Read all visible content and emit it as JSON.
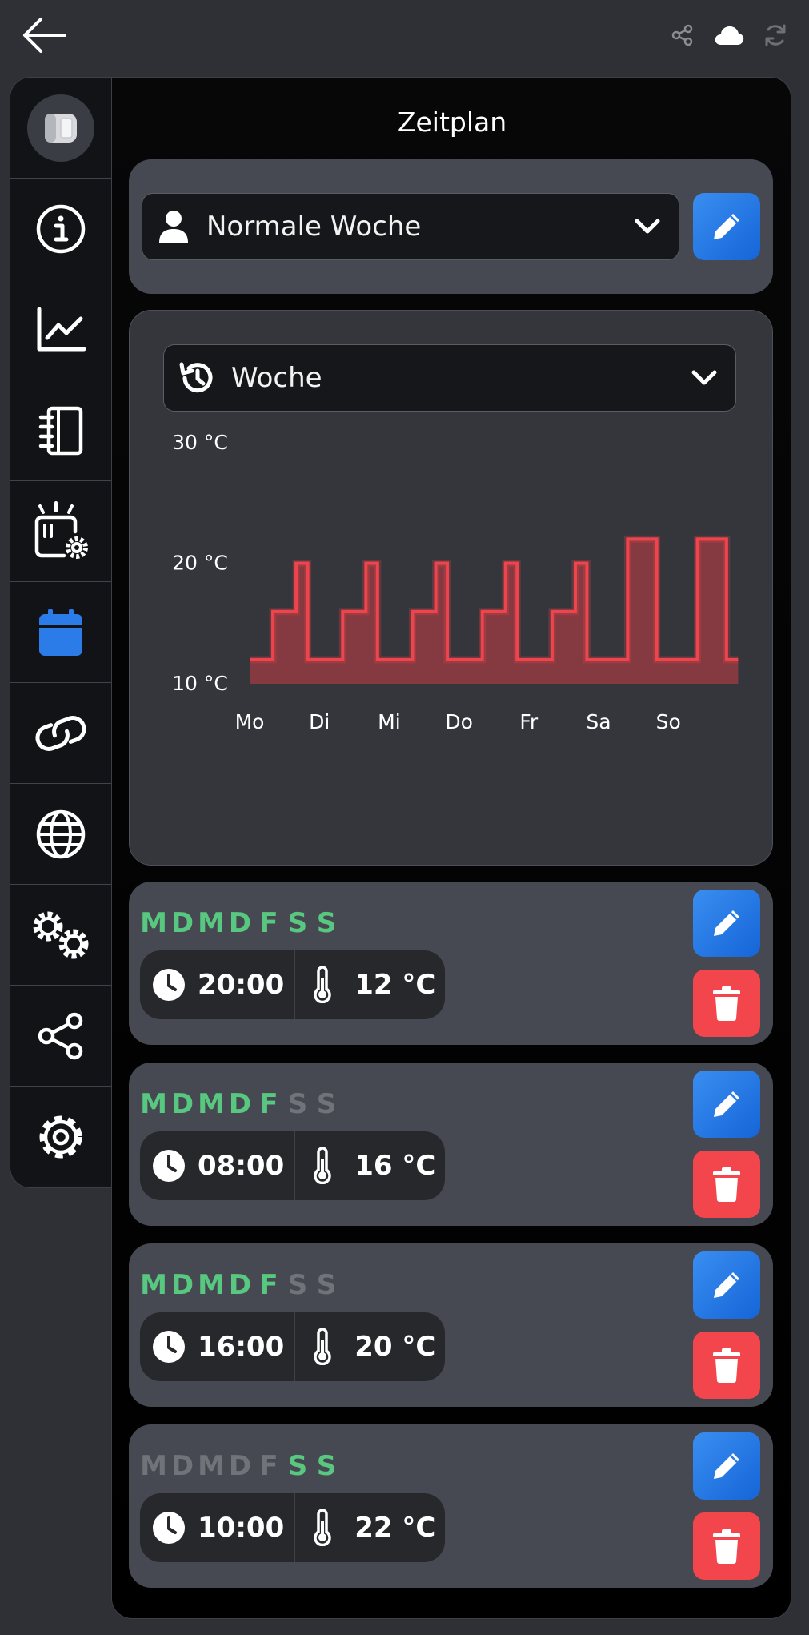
{
  "header": {
    "back_icon": "arrow-left-icon",
    "icons": [
      "share-icon",
      "cloud-icon",
      "sync-icon"
    ]
  },
  "sidebar": {
    "items": [
      {
        "name": "device",
        "icon": "thermostat-device-icon"
      },
      {
        "name": "info",
        "icon": "info-icon"
      },
      {
        "name": "history",
        "icon": "chart-line-icon"
      },
      {
        "name": "log",
        "icon": "notebook-icon"
      },
      {
        "name": "device-settings",
        "icon": "device-gear-icon"
      },
      {
        "name": "schedule",
        "icon": "calendar-icon",
        "active": true
      },
      {
        "name": "links",
        "icon": "link-icon"
      },
      {
        "name": "network",
        "icon": "globe-icon"
      },
      {
        "name": "advanced",
        "icon": "gears-icon"
      },
      {
        "name": "share",
        "icon": "share-icon"
      },
      {
        "name": "settings",
        "icon": "gear-icon"
      }
    ]
  },
  "page": {
    "title": "Zeitplan"
  },
  "profile_select": {
    "value": "Normale Woche"
  },
  "view_select": {
    "value": "Woche"
  },
  "colors": {
    "accent_blue": "#2b7ce9",
    "active_day": "#58c77f",
    "inactive_day": "#70737a",
    "delete_red": "#f2454c",
    "chart_line": "#f0444c",
    "chart_fill": "#8a3a40"
  },
  "chart_data": {
    "type": "area",
    "y_tick_labels": [
      "30 °C",
      "20 °C",
      "10 °C"
    ],
    "ylim": [
      10,
      30
    ],
    "categories": [
      "Mo",
      "Di",
      "Mi",
      "Do",
      "Fr",
      "Sa",
      "So"
    ],
    "days": [
      {
        "day": "Mo",
        "steps": [
          [
            0,
            12
          ],
          [
            8,
            16
          ],
          [
            16,
            20
          ],
          [
            20,
            12
          ]
        ]
      },
      {
        "day": "Di",
        "steps": [
          [
            0,
            12
          ],
          [
            8,
            16
          ],
          [
            16,
            20
          ],
          [
            20,
            12
          ]
        ]
      },
      {
        "day": "Mi",
        "steps": [
          [
            0,
            12
          ],
          [
            8,
            16
          ],
          [
            16,
            20
          ],
          [
            20,
            12
          ]
        ]
      },
      {
        "day": "Do",
        "steps": [
          [
            0,
            12
          ],
          [
            8,
            16
          ],
          [
            16,
            20
          ],
          [
            20,
            12
          ]
        ]
      },
      {
        "day": "Fr",
        "steps": [
          [
            0,
            12
          ],
          [
            8,
            16
          ],
          [
            16,
            20
          ],
          [
            20,
            12
          ]
        ]
      },
      {
        "day": "Sa",
        "steps": [
          [
            0,
            12
          ],
          [
            10,
            22
          ],
          [
            20,
            12
          ]
        ]
      },
      {
        "day": "So",
        "steps": [
          [
            0,
            12
          ],
          [
            10,
            22
          ],
          [
            20,
            12
          ]
        ]
      }
    ]
  },
  "entries": [
    {
      "days": [
        "M",
        "D",
        "M",
        "D",
        "F",
        "S",
        "S"
      ],
      "active": [
        true,
        true,
        true,
        true,
        true,
        true,
        true
      ],
      "time": "20:00",
      "temp": "12 °C"
    },
    {
      "days": [
        "M",
        "D",
        "M",
        "D",
        "F",
        "S",
        "S"
      ],
      "active": [
        true,
        true,
        true,
        true,
        true,
        false,
        false
      ],
      "time": "08:00",
      "temp": "16 °C"
    },
    {
      "days": [
        "M",
        "D",
        "M",
        "D",
        "F",
        "S",
        "S"
      ],
      "active": [
        true,
        true,
        true,
        true,
        true,
        false,
        false
      ],
      "time": "16:00",
      "temp": "20 °C"
    },
    {
      "days": [
        "M",
        "D",
        "M",
        "D",
        "F",
        "S",
        "S"
      ],
      "active": [
        false,
        false,
        false,
        false,
        false,
        true,
        true
      ],
      "time": "10:00",
      "temp": "22 °C"
    }
  ]
}
